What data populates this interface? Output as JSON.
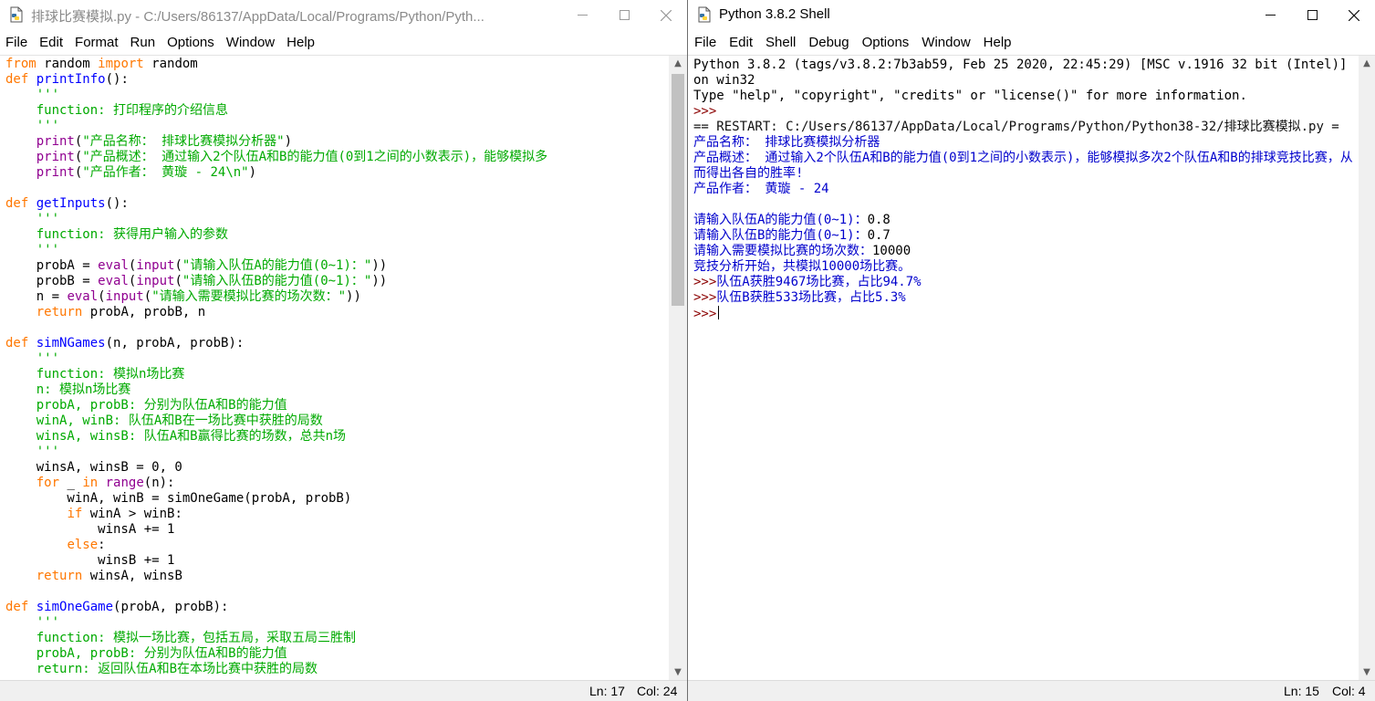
{
  "editor": {
    "title": "排球比赛模拟.py - C:/Users/86137/AppData/Local/Programs/Python/Pyth...",
    "menu": [
      "File",
      "Edit",
      "Format",
      "Run",
      "Options",
      "Window",
      "Help"
    ],
    "status": {
      "ln": "Ln: 17",
      "col": "Col: 24"
    },
    "code_lines": [
      "from random import random",
      "def printInfo():",
      "    '''",
      "    function: 打印程序的介绍信息",
      "    '''",
      "    print(\"产品名称： 排球比赛模拟分析器\")",
      "    print(\"产品概述： 通过输入2个队伍A和B的能力值(0到1之间的小数表示)，能够模拟多",
      "    print(\"产品作者： 黄璇 - 24\\n\")",
      "",
      "def getInputs():",
      "    '''",
      "    function: 获得用户输入的参数",
      "    '''",
      "    probA = eval(input(\"请输入队伍A的能力值(0~1)：\"))",
      "    probB = eval(input(\"请输入队伍B的能力值(0~1)：\"))",
      "    n = eval(input(\"请输入需要模拟比赛的场次数：\"))",
      "    return probA, probB, n",
      "",
      "def simNGames(n, probA, probB):",
      "    '''",
      "    function: 模拟n场比赛",
      "    n: 模拟n场比赛",
      "    probA, probB: 分别为队伍A和B的能力值",
      "    winA, winB: 队伍A和B在一场比赛中获胜的局数",
      "    winsA, winsB: 队伍A和B赢得比赛的场数，总共n场",
      "    '''",
      "    winsA, winsB = 0, 0",
      "    for _ in range(n):",
      "        winA, winB = simOneGame(probA, probB)",
      "        if winA > winB:",
      "            winsA += 1",
      "        else:",
      "            winsB += 1",
      "    return winsA, winsB",
      "",
      "def simOneGame(probA, probB):",
      "    '''",
      "    function: 模拟一场比赛，包括五局，采取五局三胜制",
      "    probA, probB: 分别为队伍A和B的能力值",
      "    return: 返回队伍A和B在本场比赛中获胜的局数"
    ]
  },
  "shell": {
    "title": "Python 3.8.2 Shell",
    "menu": [
      "File",
      "Edit",
      "Shell",
      "Debug",
      "Options",
      "Window",
      "Help"
    ],
    "status": {
      "ln": "Ln: 15",
      "col": "Col: 4"
    },
    "lines": [
      "Python 3.8.2 (tags/v3.8.2:7b3ab59, Feb 25 2020, 22:45:29) [MSC v.1916 32 bit (Intel)] on win32",
      "Type \"help\", \"copyright\", \"credits\" or \"license()\" for more information.",
      ">>>",
      "== RESTART: C:/Users/86137/AppData/Local/Programs/Python/Python38-32/排球比赛模拟.py =",
      "产品名称： 排球比赛模拟分析器",
      "产品概述： 通过输入2个队伍A和B的能力值(0到1之间的小数表示)，能够模拟多次2个队伍A和B的排球竞技比赛，从而得出各自的胜率!",
      "产品作者： 黄璇 - 24",
      "",
      "请输入队伍A的能力值(0~1)：",
      "0.8",
      "请输入队伍B的能力值(0~1)：",
      "0.7",
      "请输入需要模拟比赛的场次数：",
      "10000",
      "竞技分析开始，共模拟10000场比赛。",
      ">>>",
      "队伍A获胜9467场比赛，占比94.7%",
      "队伍B获胜533场比赛，占比5.3%",
      ">>>"
    ]
  }
}
